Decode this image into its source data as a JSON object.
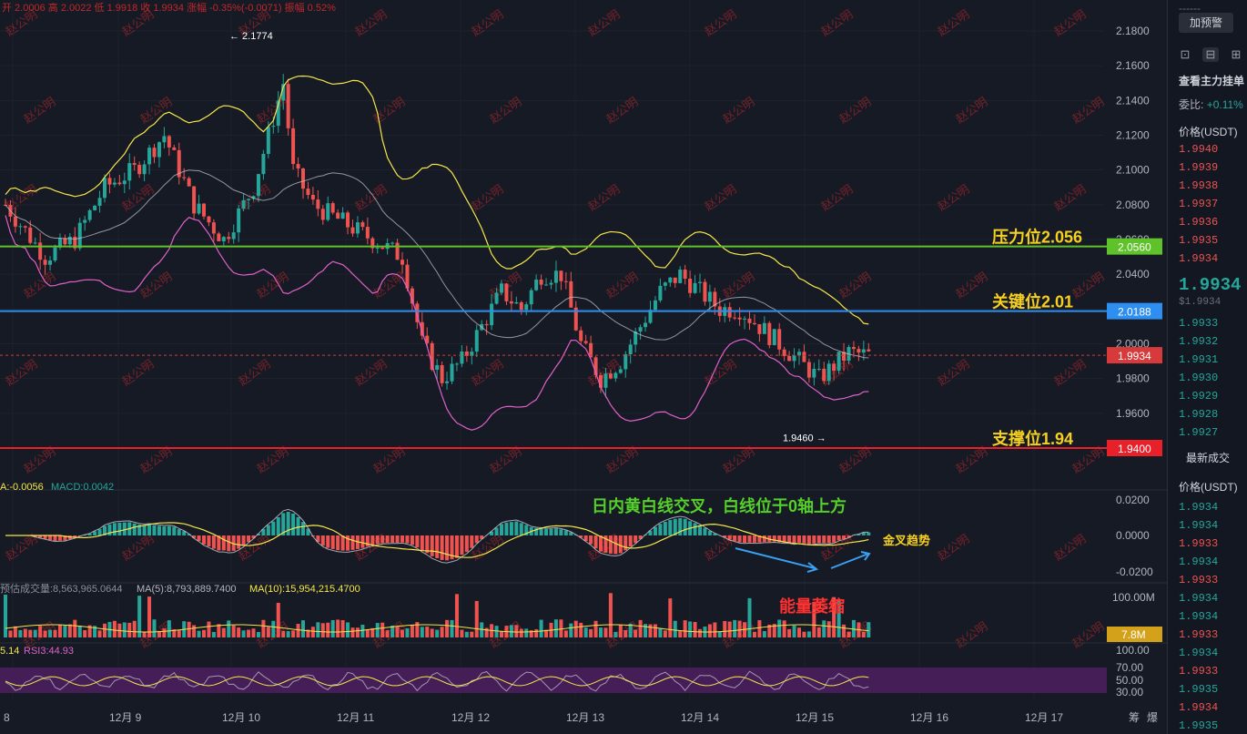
{
  "colors": {
    "up": "#26a69a",
    "down": "#ef5350",
    "ma_white": "#c9ccd4",
    "ma_yellow": "#f5e64a",
    "boll_lower": "#e060c8",
    "resistance": "#5fc22a",
    "key": "#2f8ff0",
    "support": "#e8202a",
    "annotation_yellow": "#f5d020",
    "annotation_green": "#55d02a",
    "annotation_red": "#ff3030",
    "arrow_blue": "#3aa0f0",
    "watermark": "#c0282a",
    "rsi_band": "#4a1f5e"
  },
  "header": {
    "text": "开 2.0006  高 2.0022  低 1.9918  收 1.9934  涨幅 -0.35%(-0.0071)  振幅 0.52%"
  },
  "watermark": "赵公明",
  "chart_data": {
    "type": "candlestick",
    "price_axis": {
      "ylim": [
        1.93,
        2.19
      ],
      "ticks": [
        "2.1800",
        "2.1600",
        "2.1400",
        "2.1200",
        "2.1000",
        "2.0800",
        "2.0600",
        "2.0400",
        "2.0200",
        "2.0000",
        "1.9800",
        "1.9600"
      ]
    },
    "x_axis": {
      "labels": [
        "8",
        "12月 9",
        "12月 10",
        "12月 11",
        "12月 12",
        "12月 13",
        "12月 14",
        "12月 15",
        "12月 16",
        "12月 17"
      ]
    },
    "last_price": 1.9934,
    "price_tags": [
      {
        "value": "2.0560",
        "color": "#5fc22a"
      },
      {
        "value": "2.0188",
        "color": "#2f8ff0"
      },
      {
        "value": "1.9934",
        "color": "#d63a3a"
      },
      {
        "value": "1.9400",
        "color": "#e8202a"
      }
    ],
    "levels": [
      {
        "name": "resistance",
        "value": 2.056,
        "label": "压力位2.056"
      },
      {
        "name": "key",
        "value": 2.0188,
        "label": "关键位2.01"
      },
      {
        "name": "support",
        "value": 1.94,
        "label": "支撑位1.94"
      }
    ],
    "high_marker": {
      "value": 2.1774,
      "label": "← 2.1774"
    },
    "low_marker": {
      "value": 1.946,
      "label": "1.9460 →"
    },
    "price_path": [
      [
        0,
        2.08
      ],
      [
        8,
        2.05
      ],
      [
        14,
        2.06
      ],
      [
        20,
        2.09
      ],
      [
        26,
        2.1
      ],
      [
        32,
        2.12
      ],
      [
        38,
        2.08
      ],
      [
        44,
        2.06
      ],
      [
        50,
        2.09
      ],
      [
        56,
        2.15
      ],
      [
        58,
        2.1
      ],
      [
        62,
        2.08
      ],
      [
        68,
        2.07
      ],
      [
        74,
        2.06
      ],
      [
        80,
        2.05
      ],
      [
        84,
        2.0
      ],
      [
        88,
        1.98
      ],
      [
        92,
        1.99
      ],
      [
        96,
        2.01
      ],
      [
        100,
        2.03
      ],
      [
        104,
        2.02
      ],
      [
        108,
        2.04
      ],
      [
        112,
        2.04
      ],
      [
        116,
        2.0
      ],
      [
        120,
        1.98
      ],
      [
        124,
        1.99
      ],
      [
        128,
        2.01
      ],
      [
        132,
        2.03
      ],
      [
        136,
        2.04
      ],
      [
        140,
        2.03
      ],
      [
        144,
        2.02
      ],
      [
        148,
        2.02
      ],
      [
        152,
        2.01
      ],
      [
        156,
        2.0
      ],
      [
        160,
        1.99
      ],
      [
        164,
        1.98
      ],
      [
        166,
        1.985
      ],
      [
        170,
        1.995
      ],
      [
        174,
        1.9934
      ]
    ],
    "macd": {
      "label": "MACD:0.0042",
      "prefix": "A:-0.0056",
      "ticks": [
        "0.0200",
        "0.0000",
        "-0.0200"
      ],
      "annotation": "日内黄白线交叉，白线位于0轴上方",
      "signal_label": "金叉趋势"
    },
    "volume": {
      "header": "预估成交量:8,563,965.0644",
      "ma5": "MA(5):8,793,889.7400",
      "ma10": "MA(10):15,954,215.4700",
      "tick": "100.00M",
      "last_tag": "7.8M",
      "annotation": "能量萎缩"
    },
    "rsi": {
      "prefix": "5.14",
      "label": "RSI3:44.93",
      "ticks": [
        "100.00",
        "70.00",
        "50.00",
        "30.00"
      ]
    }
  },
  "bottom_right": [
    "筹",
    "爆"
  ],
  "right_panel": {
    "button": "加预警",
    "dashes": "------",
    "title": "查看主力挂单",
    "ratio_label": "委比:",
    "ratio_value": "+0.11%",
    "price_header": "价格(USDT)",
    "asks": [
      "1.9940",
      "1.9939",
      "1.9938",
      "1.9937",
      "1.9936",
      "1.9935",
      "1.9934"
    ],
    "last": "1.9934",
    "last_usd": "$1.9934",
    "bids": [
      "1.9933",
      "1.9932",
      "1.9931",
      "1.9930",
      "1.9929",
      "1.9928",
      "1.9927"
    ],
    "trades_title": "最新成交",
    "trades_header": "价格(USDT)",
    "trades": [
      {
        "p": "1.9934",
        "c": "up"
      },
      {
        "p": "1.9934",
        "c": "up"
      },
      {
        "p": "1.9933",
        "c": "down"
      },
      {
        "p": "1.9934",
        "c": "up"
      },
      {
        "p": "1.9933",
        "c": "down"
      },
      {
        "p": "1.9934",
        "c": "up"
      },
      {
        "p": "1.9934",
        "c": "up"
      },
      {
        "p": "1.9933",
        "c": "down"
      },
      {
        "p": "1.9934",
        "c": "up"
      },
      {
        "p": "1.9933",
        "c": "down"
      },
      {
        "p": "1.9935",
        "c": "up"
      },
      {
        "p": "1.9934",
        "c": "down"
      },
      {
        "p": "1.9935",
        "c": "up"
      }
    ]
  }
}
